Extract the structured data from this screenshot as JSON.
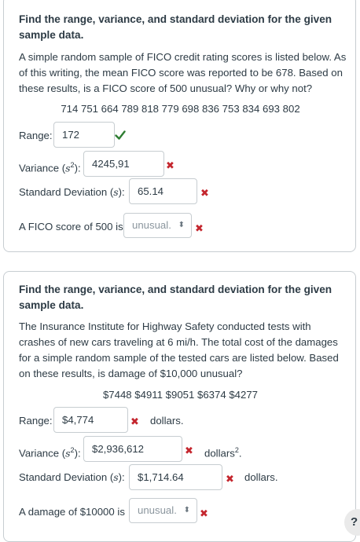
{
  "q1": {
    "title": "Find the range, variance, and standard deviation for the given sample data.",
    "body": "A simple random sample of FICO credit rating scores is listed below. As of this writing, the mean FICO score was reported to be 678. Based on these results, is a FICO score of 500 unusual? Why or why not?",
    "data": "714 751 664 789 818 779 698 836 753 834 693 802",
    "range_label": "Range:",
    "range_value": "172",
    "variance_label": "Variance (",
    "variance_var": "s",
    "variance_sup": "2",
    "variance_end": "):",
    "variance_value": "4245,91",
    "sd_label": "Standard Deviation (",
    "sd_var": "s",
    "sd_end": "):",
    "sd_value": "65.14",
    "fico_label": "A FICO score of 500 is",
    "fico_select": "unusual."
  },
  "q2": {
    "title": "Find the range, variance, and standard deviation for the given sample data.",
    "body": "The Insurance Institute for Highway Safety conducted tests with crashes of new cars traveling at 6 mi/h. The total cost of the damages for a simple random sample of the tested cars are listed below. Based on these results, is damage of $10,000 unusual?",
    "data": "$7448 $4911 $9051 $6374 $4277",
    "range_label": "Range:",
    "range_value": "$4,774",
    "range_unit": "dollars.",
    "variance_label": "Variance (",
    "variance_var": "s",
    "variance_sup": "2",
    "variance_end": "):",
    "variance_value": "$2,936,612",
    "variance_unit": "dollars",
    "variance_unit_sup": "2",
    "variance_unit_end": ".",
    "sd_label": "Standard Deviation (",
    "sd_var": "s",
    "sd_end": "):",
    "sd_value": "$1,714.64",
    "sd_unit": "dollars.",
    "damage_label": "A damage of $10000 is",
    "damage_select": "unusual."
  },
  "ui": {
    "select_arrows": "⬍",
    "wrong_mark": "✖",
    "help_button": "?",
    "correct_color": "#2e7d32",
    "wrong_color": "#c4262e"
  }
}
